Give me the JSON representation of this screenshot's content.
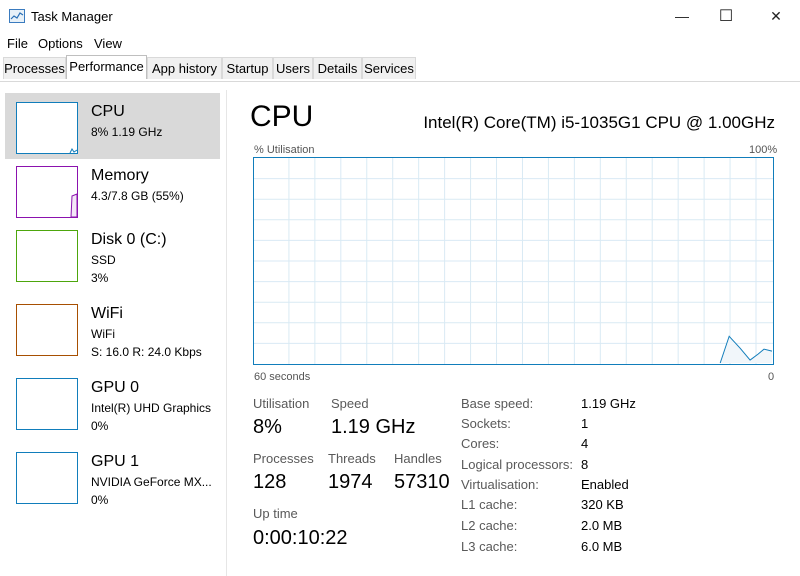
{
  "window": {
    "title": "Task Manager",
    "minimize_glyph": "—",
    "maximize_glyph": "☐",
    "close_glyph": "✕"
  },
  "menu": [
    "File",
    "Options",
    "View"
  ],
  "tabs": [
    {
      "label": "Processes",
      "active": false
    },
    {
      "label": "Performance",
      "active": true
    },
    {
      "label": "App history",
      "active": false
    },
    {
      "label": "Startup",
      "active": false
    },
    {
      "label": "Users",
      "active": false
    },
    {
      "label": "Details",
      "active": false
    },
    {
      "label": "Services",
      "active": false
    }
  ],
  "sidebar": [
    {
      "name": "CPU",
      "line2": "8%  1.19 GHz",
      "line3": "",
      "color": "#117dbb",
      "active": true,
      "icon": "cpu-thumbnail-icon"
    },
    {
      "name": "Memory",
      "line2": "4.3/7.8 GB (55%)",
      "line3": "",
      "color": "#8b12ae",
      "active": false,
      "icon": "memory-thumbnail-icon"
    },
    {
      "name": "Disk 0 (C:)",
      "line2": "SSD",
      "line3": "3%",
      "color": "#4da60c",
      "active": false,
      "icon": "disk-thumbnail-icon"
    },
    {
      "name": "WiFi",
      "line2": "WiFi",
      "line3": "S: 16.0  R: 24.0 Kbps",
      "color": "#a74f01",
      "active": false,
      "icon": "wifi-thumbnail-icon"
    },
    {
      "name": "GPU 0",
      "line2": "Intel(R) UHD Graphics",
      "line3": "0%",
      "color": "#117dbb",
      "active": false,
      "icon": "gpu0-thumbnail-icon"
    },
    {
      "name": "GPU 1",
      "line2": "NVIDIA GeForce MX...",
      "line3": "0%",
      "color": "#117dbb",
      "active": false,
      "icon": "gpu1-thumbnail-icon"
    }
  ],
  "main": {
    "title": "CPU",
    "model": "Intel(R) Core(TM) i5-1035G1 CPU @ 1.00GHz",
    "graph": {
      "y_label": "% Utilisation",
      "y_max_label": "100%",
      "x_left_label": "60 seconds",
      "x_right_label": "0",
      "line_color": "#117dbb",
      "grid_color": "#d9eaf4",
      "fill_color": "#f1f6fa"
    },
    "stats": {
      "utilisation_label": "Utilisation",
      "utilisation": "8%",
      "speed_label": "Speed",
      "speed": "1.19 GHz",
      "processes_label": "Processes",
      "processes": "128",
      "threads_label": "Threads",
      "threads": "1974",
      "handles_label": "Handles",
      "handles": "57310",
      "uptime_label": "Up time",
      "uptime": "0:00:10:22"
    },
    "specs": [
      {
        "label": "Base speed:",
        "value": "1.19 GHz"
      },
      {
        "label": "Sockets:",
        "value": "1"
      },
      {
        "label": "Cores:",
        "value": "4"
      },
      {
        "label": "Logical processors:",
        "value": "8"
      },
      {
        "label": "Virtualisation:",
        "value": "Enabled"
      },
      {
        "label": "L1 cache:",
        "value": "320 KB"
      },
      {
        "label": "L2 cache:",
        "value": "2.0 MB"
      },
      {
        "label": "L3 cache:",
        "value": "6.0 MB"
      }
    ]
  }
}
